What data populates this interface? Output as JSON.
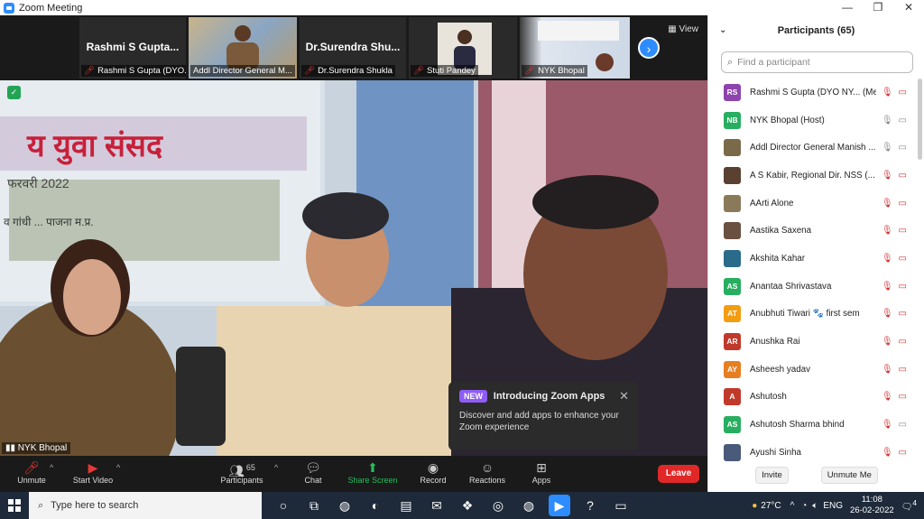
{
  "window": {
    "title": "Zoom Meeting"
  },
  "strip": {
    "view_label": "View",
    "tiles": [
      {
        "big_name": "Rashmi S Gupta...",
        "tag": "Rashmi S Gupta (DYO..."
      },
      {
        "big_name": "",
        "tag": "Addl Director General M..."
      },
      {
        "big_name": "Dr.Surendra Shu...",
        "tag": "Dr.Surendra Shukla"
      },
      {
        "big_name": "",
        "tag": "Stuti Pandey"
      },
      {
        "big_name": "",
        "tag": "NYK Bhopal"
      }
    ]
  },
  "main_video": {
    "label": "NYK Bhopal",
    "banner_text_1": "य युवा संसद",
    "banner_text_2": "फरवरी 2022",
    "banner_text_3": "व गांधी ... पाजना म.प्र."
  },
  "popup": {
    "badge": "NEW",
    "title": "Introducing Zoom Apps",
    "body": "Discover and add apps to enhance your Zoom experience"
  },
  "toolbar": {
    "unmute": "Unmute",
    "start_video": "Start Video",
    "participants": "Participants",
    "participants_count": "65",
    "chat": "Chat",
    "share_screen": "Share Screen",
    "record": "Record",
    "reactions": "Reactions",
    "apps": "Apps",
    "leave": "Leave"
  },
  "panel": {
    "title": "Participants (65)",
    "search_placeholder": "Find a participant",
    "invite": "Invite",
    "unmute_me": "Unmute Me",
    "participants": [
      {
        "initials": "RS",
        "color": "#8e44ad",
        "name": "Rashmi S Gupta (DYO NY... (Me)",
        "mic": "muted",
        "video": "off"
      },
      {
        "initials": "NB",
        "color": "#27ae60",
        "name": "NYK Bhopal (Host)",
        "mic": "on",
        "video": "on"
      },
      {
        "initials": "",
        "color": "#7a6a4a",
        "name": "Addl Director General Manish ...",
        "mic": "on",
        "video": "on"
      },
      {
        "initials": "",
        "color": "#5a4030",
        "name": "A S Kabir, Regional Dir. NSS (...",
        "mic": "muted",
        "video": "off"
      },
      {
        "initials": "",
        "color": "#8a7a5a",
        "name": "AArti Alone",
        "mic": "muted",
        "video": "off"
      },
      {
        "initials": "",
        "color": "#6a5040",
        "name": "Aastika Saxena",
        "mic": "muted",
        "video": "off"
      },
      {
        "initials": "",
        "color": "#2a6a8a",
        "name": "Akshita Kahar",
        "mic": "muted",
        "video": "off"
      },
      {
        "initials": "AS",
        "color": "#27ae60",
        "name": "Anantaa Shrivastava",
        "mic": "muted",
        "video": "off"
      },
      {
        "initials": "AT",
        "color": "#f39c12",
        "name": "Anubhuti Tiwari 🐾 first sem",
        "mic": "muted",
        "video": "off"
      },
      {
        "initials": "AR",
        "color": "#c0392b",
        "name": "Anushka Rai",
        "mic": "muted",
        "video": "off"
      },
      {
        "initials": "AY",
        "color": "#e67e22",
        "name": "Asheesh yadav",
        "mic": "muted",
        "video": "off"
      },
      {
        "initials": "A",
        "color": "#c0392b",
        "name": "Ashutosh",
        "mic": "muted",
        "video": "off"
      },
      {
        "initials": "AS",
        "color": "#27ae60",
        "name": "Ashutosh Sharma bhind",
        "mic": "muted",
        "video": "on"
      },
      {
        "initials": "",
        "color": "#4a5a7a",
        "name": "Ayushi Sinha",
        "mic": "muted",
        "video": "off"
      }
    ]
  },
  "taskbar": {
    "search_placeholder": "Type here to search",
    "weather": "27°C",
    "lang": "ENG",
    "time": "11:08",
    "date": "26-02-2022",
    "notif_count": "4"
  }
}
